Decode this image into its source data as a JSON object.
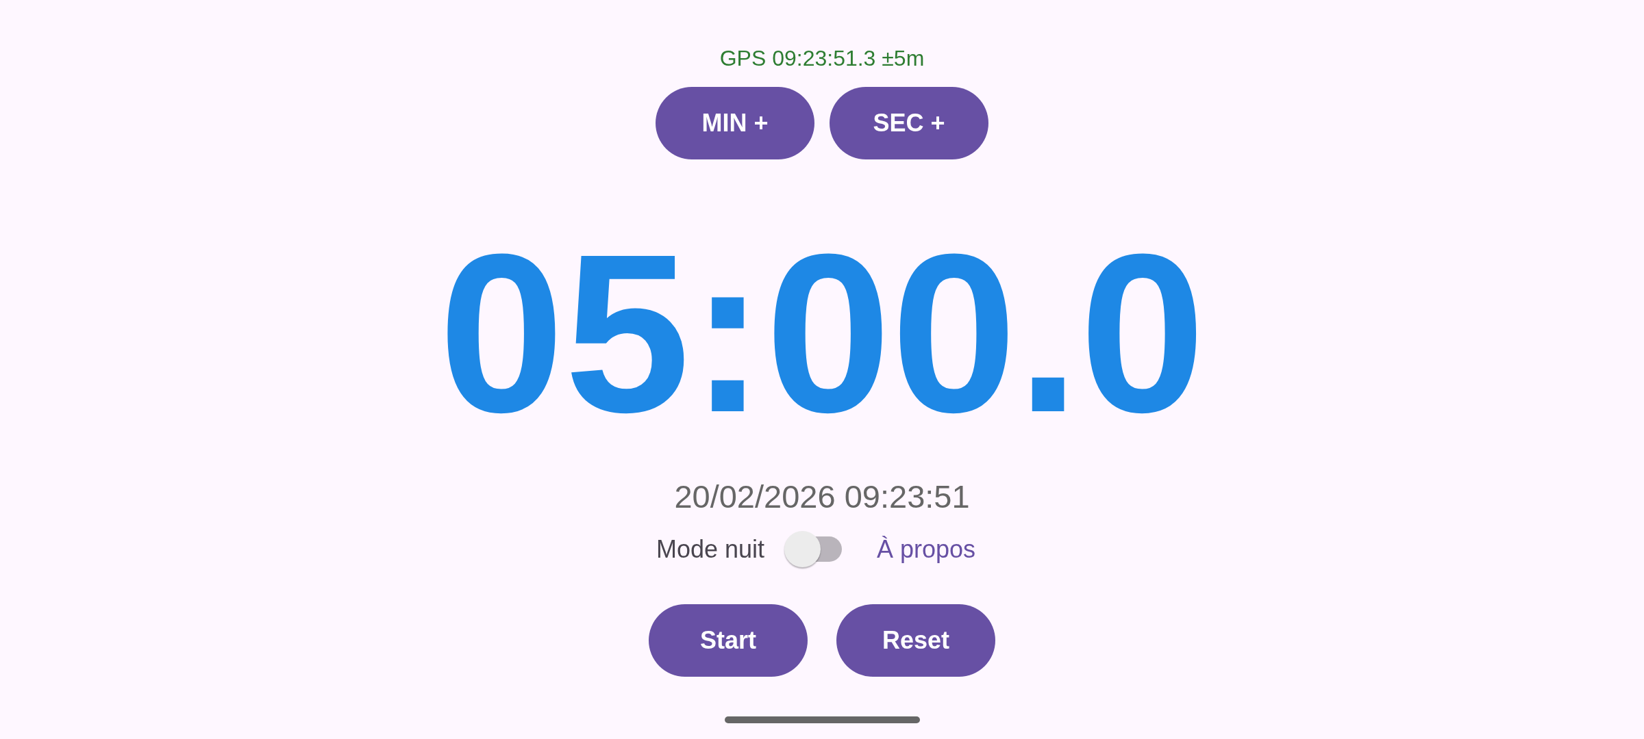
{
  "gps_status": "GPS 09:23:51.3 ±5m",
  "adjust_buttons": [
    "MIN +",
    "SEC +"
  ],
  "timer": "05:00.0",
  "datetime": "20/02/2026 09:23:51",
  "night_mode": {
    "label": "Mode nuit",
    "on": false
  },
  "about_link": "À propos",
  "action_buttons": [
    "Start",
    "Reset"
  ]
}
